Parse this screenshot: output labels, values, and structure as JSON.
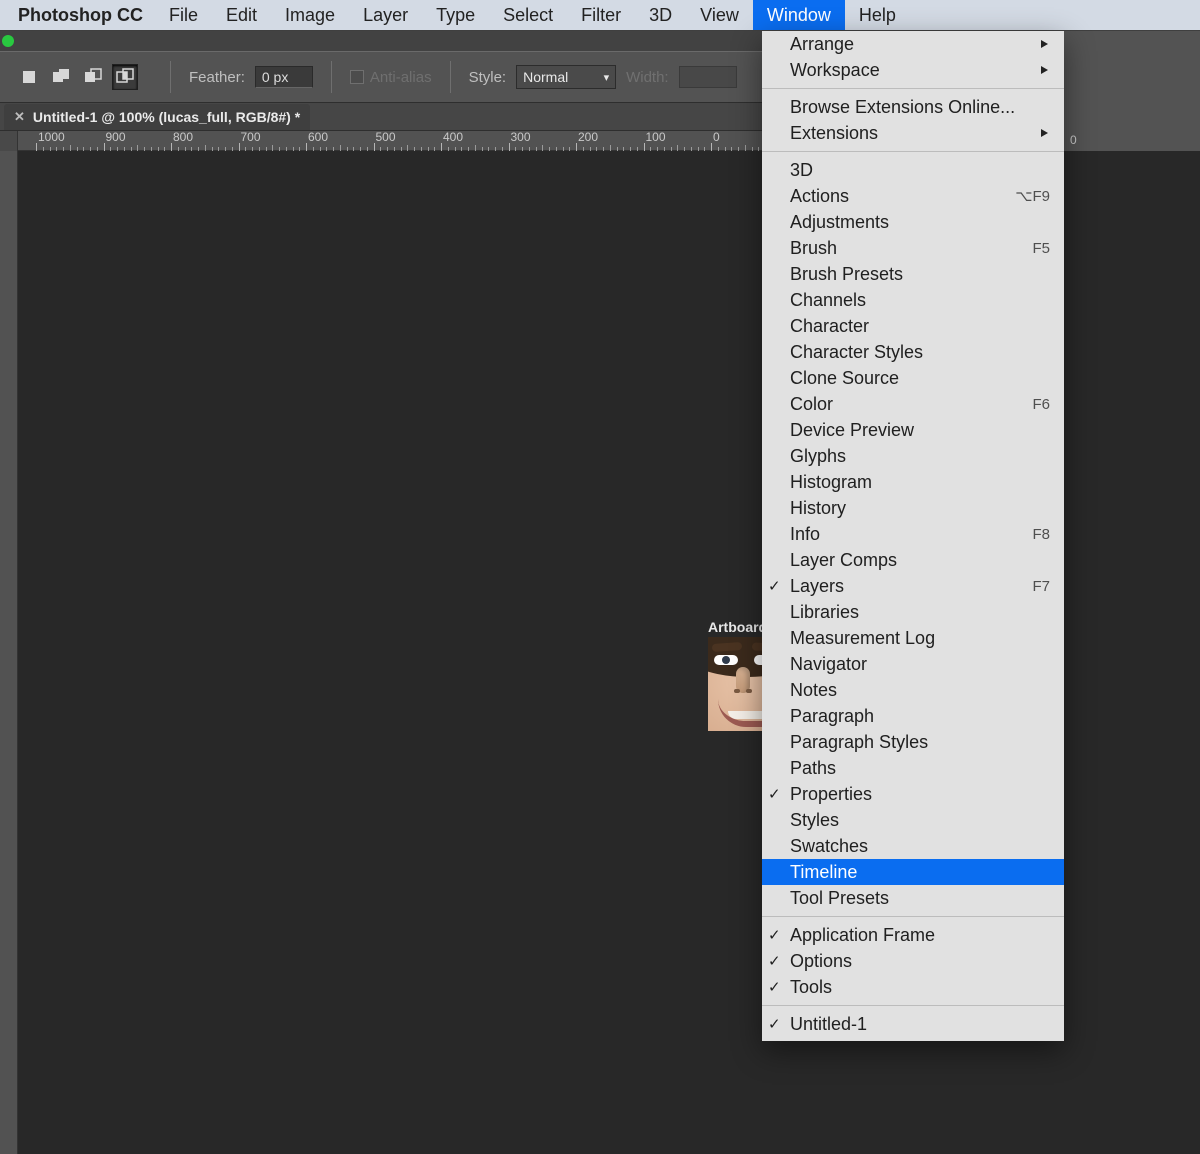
{
  "menubar": {
    "app": "Photoshop CC",
    "items": [
      "File",
      "Edit",
      "Image",
      "Layer",
      "Type",
      "Select",
      "Filter",
      "3D",
      "View",
      "Window",
      "Help"
    ],
    "active": "Window"
  },
  "optionsBar": {
    "featherLabel": "Feather:",
    "featherValue": "0 px",
    "antiAlias": "Anti-alias",
    "styleLabel": "Style:",
    "styleValue": "Normal",
    "widthLabel": "Width:",
    "widthValue": ""
  },
  "documentTab": {
    "title": "Untitled-1 @ 100% (lucas_full, RGB/8#) *"
  },
  "ruler": {
    "labels": [
      "1000",
      "900",
      "800",
      "700",
      "600",
      "500",
      "400",
      "300",
      "200",
      "100",
      "0"
    ],
    "rightLabel": "0",
    "spacing": 67.5,
    "offset": 18
  },
  "artboard": {
    "label": "Artboard"
  },
  "windowMenu": {
    "groups": [
      [
        {
          "label": "Arrange",
          "submenu": true
        },
        {
          "label": "Workspace",
          "submenu": true
        }
      ],
      [
        {
          "label": "Browse Extensions Online..."
        },
        {
          "label": "Extensions",
          "submenu": true
        }
      ],
      [
        {
          "label": "3D"
        },
        {
          "label": "Actions",
          "shortcut": "⌥F9"
        },
        {
          "label": "Adjustments"
        },
        {
          "label": "Brush",
          "shortcut": "F5"
        },
        {
          "label": "Brush Presets"
        },
        {
          "label": "Channels"
        },
        {
          "label": "Character"
        },
        {
          "label": "Character Styles"
        },
        {
          "label": "Clone Source"
        },
        {
          "label": "Color",
          "shortcut": "F6"
        },
        {
          "label": "Device Preview"
        },
        {
          "label": "Glyphs"
        },
        {
          "label": "Histogram"
        },
        {
          "label": "History"
        },
        {
          "label": "Info",
          "shortcut": "F8"
        },
        {
          "label": "Layer Comps"
        },
        {
          "label": "Layers",
          "shortcut": "F7",
          "checked": true
        },
        {
          "label": "Libraries"
        },
        {
          "label": "Measurement Log"
        },
        {
          "label": "Navigator"
        },
        {
          "label": "Notes"
        },
        {
          "label": "Paragraph"
        },
        {
          "label": "Paragraph Styles"
        },
        {
          "label": "Paths"
        },
        {
          "label": "Properties",
          "checked": true
        },
        {
          "label": "Styles"
        },
        {
          "label": "Swatches"
        },
        {
          "label": "Timeline",
          "highlight": true
        },
        {
          "label": "Tool Presets"
        }
      ],
      [
        {
          "label": "Application Frame",
          "checked": true
        },
        {
          "label": "Options",
          "checked": true
        },
        {
          "label": "Tools",
          "checked": true
        }
      ],
      [
        {
          "label": "Untitled-1",
          "checked": true
        }
      ]
    ]
  }
}
